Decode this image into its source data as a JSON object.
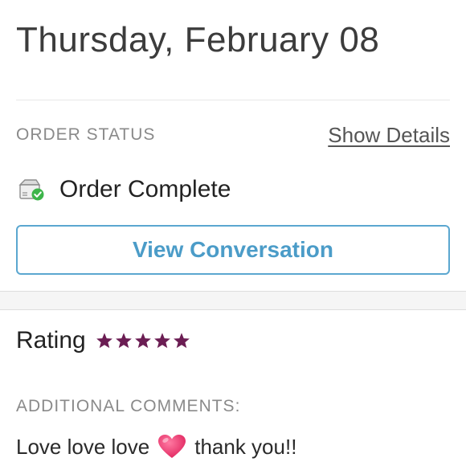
{
  "header": {
    "date": "Thursday, February 08"
  },
  "order": {
    "status_label": "ORDER STATUS",
    "show_details_label": "Show Details",
    "status_text": "Order Complete",
    "status_icon": "package-check-icon",
    "status_color": "#3db54a"
  },
  "actions": {
    "view_conversation_label": "View Conversation",
    "accent": "#4b9cc8"
  },
  "rating": {
    "label": "Rating",
    "stars": 5,
    "max_stars": 5,
    "star_color": "#6b1d53"
  },
  "comments": {
    "label": "ADDITIONAL COMMENTS:",
    "text_before": "Love love love",
    "emoji": "heart-icon",
    "text_after": "thank you!!"
  }
}
